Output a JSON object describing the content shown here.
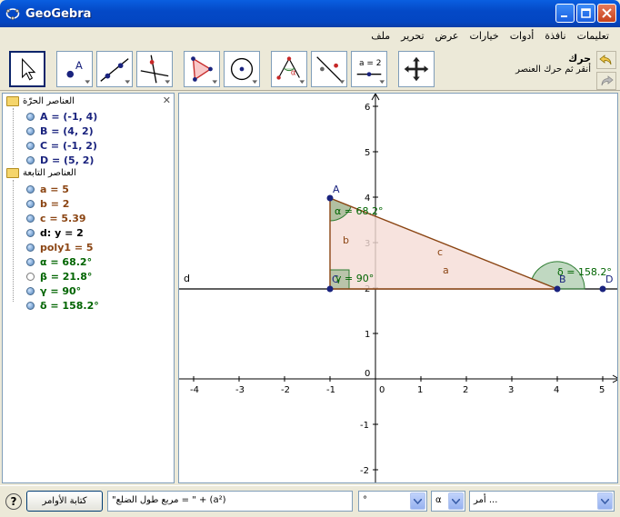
{
  "window": {
    "title": "GeoGebra"
  },
  "menu": [
    "ملف",
    "تحرير",
    "عرض",
    "خيارات",
    "أدوات",
    "نافذة",
    "تعليمات"
  ],
  "tool_help": {
    "name": "حرك",
    "description": "أنقر ثم حرك العنصر"
  },
  "toolbar_slider_label": "a = 2",
  "algebra": {
    "free_header": "العناصر الحرّة",
    "dependent_header": "العناصر التابعة",
    "free": [
      {
        "text": "A = (-1, 4)",
        "color": "#1a237e"
      },
      {
        "text": "B = (4, 2)",
        "color": "#1a237e"
      },
      {
        "text": "C = (-1, 2)",
        "color": "#1a237e"
      },
      {
        "text": "D = (5, 2)",
        "color": "#1a237e"
      }
    ],
    "dependent": [
      {
        "text": "a = 5",
        "color": "#8b4513",
        "visible": true
      },
      {
        "text": "b = 2",
        "color": "#8b4513",
        "visible": true
      },
      {
        "text": "c = 5.39",
        "color": "#8b4513",
        "visible": true
      },
      {
        "text": "d: y = 2",
        "color": "#000000",
        "visible": true
      },
      {
        "text": "poly1 = 5",
        "color": "#8b4513",
        "visible": true
      },
      {
        "text": "α = 68.2°",
        "color": "#006400",
        "visible": true
      },
      {
        "text": "β = 21.8°",
        "color": "#006400",
        "visible": false
      },
      {
        "text": "γ = 90°",
        "color": "#006400",
        "visible": true
      },
      {
        "text": "δ = 158.2°",
        "color": "#006400",
        "visible": true
      }
    ]
  },
  "graphics": {
    "x_ticks": [
      "-4",
      "-3",
      "-2",
      "-1",
      "0",
      "1",
      "2",
      "3",
      "4",
      "5"
    ],
    "y_ticks": [
      "6",
      "5",
      "4",
      "3",
      "2",
      "1",
      "0",
      "-1",
      "-2"
    ],
    "labels": {
      "A": "A",
      "B": "B",
      "C": "C",
      "D": "D",
      "d": "d",
      "a": "a",
      "b": "b",
      "c": "c",
      "alpha": "α = 68.2°",
      "gamma": "γ = 90°",
      "delta": "δ = 158.2°"
    },
    "colors": {
      "segment": "#8b4513",
      "poly_fill": "#f5dcd6",
      "angle_fill": "#2e7d32",
      "point": "#1a237e"
    }
  },
  "inputbar": {
    "help": "?",
    "command_button": "كتابة الأوامر",
    "input_value": "\"مربع طول الضلع = \" + (a²)",
    "degree_combo": "°",
    "alpha_combo": "α",
    "command_combo": "أمر ..."
  }
}
